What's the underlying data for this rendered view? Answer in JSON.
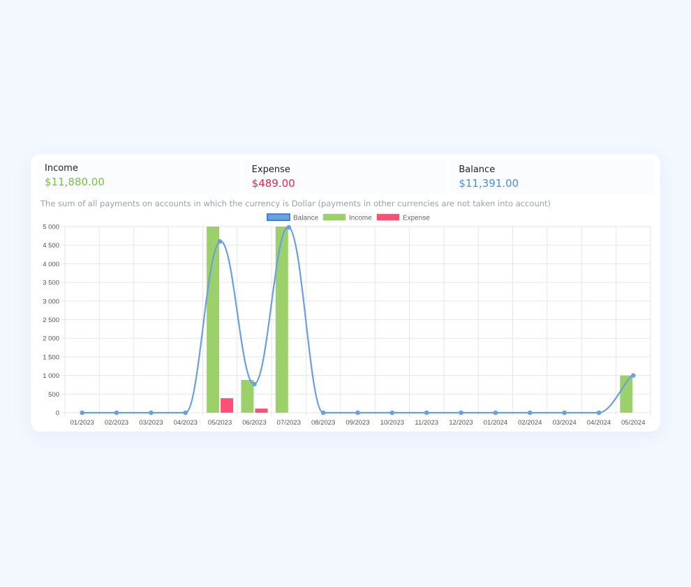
{
  "summary": {
    "income": {
      "label": "Income",
      "value": "$11,880.00",
      "color": "#7bc043"
    },
    "expense": {
      "label": "Expense",
      "value": "$489.00",
      "color": "#e8254f"
    },
    "balance": {
      "label": "Balance",
      "value": "$11,391.00",
      "color": "#4a90d9"
    }
  },
  "note": "The sum of all payments on accounts in which the currency is Dollar (payments in other currencies are not taken into account)",
  "chart_data": {
    "type": "bar",
    "categories": [
      "01/2023",
      "02/2023",
      "03/2023",
      "04/2023",
      "05/2023",
      "06/2023",
      "07/2023",
      "08/2023",
      "09/2023",
      "10/2023",
      "11/2023",
      "12/2023",
      "01/2024",
      "02/2024",
      "03/2024",
      "04/2024",
      "05/2024"
    ],
    "series": [
      {
        "name": "Balance",
        "type": "line",
        "color": "#6a9fe0",
        "values": [
          0,
          0,
          0,
          0,
          4600,
          770,
          4980,
          0,
          0,
          0,
          0,
          0,
          0,
          0,
          0,
          0,
          1000
        ]
      },
      {
        "name": "Income",
        "type": "bar",
        "color": "#9bd06b",
        "values": [
          0,
          0,
          0,
          0,
          5000,
          880,
          5000,
          0,
          0,
          0,
          0,
          0,
          0,
          0,
          0,
          0,
          1000
        ]
      },
      {
        "name": "Expense",
        "type": "bar",
        "color": "#ff4f78",
        "values": [
          0,
          0,
          0,
          0,
          390,
          110,
          0,
          0,
          0,
          0,
          0,
          0,
          0,
          0,
          0,
          0,
          0
        ]
      }
    ],
    "ylim": [
      0,
      5000
    ],
    "yticks": [
      "0",
      "500",
      "1 000",
      "1 500",
      "2 000",
      "2 500",
      "3 000",
      "3 500",
      "4 000",
      "4 500",
      "5 000"
    ],
    "grid": true,
    "legend": "top-center"
  }
}
